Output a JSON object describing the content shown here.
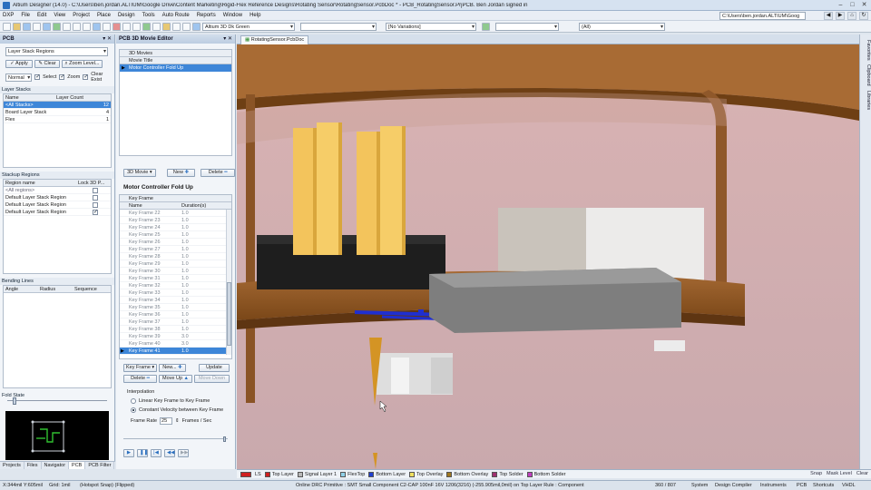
{
  "app": {
    "title": "Altium Designer (14.0) - C:\\Users\\ben.jordan.ALTIUM\\Google Drive\\Content Marketing\\Rigid-Flex Reference Designs\\Rotating Sensor\\RotatingSensor.PcbDoc * - PCB_RotatingSensor.PrjPCB. Ben Jordan signed in",
    "min_glyph": "–",
    "max_glyph": "□",
    "close_glyph": "✕"
  },
  "menu": {
    "items": [
      "DXP",
      "File",
      "Edit",
      "View",
      "Project",
      "Place",
      "Design",
      "Tools",
      "Auto Route",
      "Reports",
      "Window",
      "Help"
    ],
    "path": "C:\\Users\\ben.jordan.ALTIUM\\Goog"
  },
  "toolbar": {
    "view_config": "Altium 3D Dk Green",
    "variations": "[No Variations]",
    "filter": "(All)"
  },
  "pcb_panel": {
    "title": "PCB",
    "mode": "Layer Stack Regions",
    "apply": "Apply",
    "clear": "Clear",
    "zoom_level": "Zoom Level...",
    "normal": "Normal",
    "select": "Select",
    "zoom": "Zoom",
    "clear_existing": "Clear Exist",
    "layer_stacks": {
      "heading": "Layer Stacks",
      "col_name": "Name",
      "col_count": "Layer Count",
      "rows": [
        {
          "name": "<All Stacks>",
          "count": "12"
        },
        {
          "name": "Board Layer Stack",
          "count": "4"
        },
        {
          "name": "Flex",
          "count": "1"
        }
      ]
    },
    "stackup_regions": {
      "heading": "Stackup Regions",
      "col_name": "Region name",
      "col_lock": "Lock 3D P...",
      "rows": [
        {
          "name": "<All regions>",
          "locked": false
        },
        {
          "name": "Default Layer Stack Region",
          "locked": false
        },
        {
          "name": "Default Layer Stack Region",
          "locked": false
        },
        {
          "name": "Default Layer Stack Region",
          "locked": true
        }
      ]
    },
    "bending_lines": {
      "heading": "Bending Lines",
      "col_angle": "Angle",
      "col_radius": "Radius",
      "col_sequence": "Sequence"
    },
    "fold_state": "Fold State",
    "tabs": [
      "Projects",
      "Files",
      "Navigator",
      "PCB",
      "PCB Filter"
    ]
  },
  "movie_panel": {
    "title": "PCB 3D Movie Editor",
    "movies_heading": "3D Movies",
    "movie_title_col": "Movie Title",
    "movie_selected": "Motor Controller Fold Up",
    "btn_3d_movie": "3D Movie",
    "btn_new": "New",
    "btn_delete": "Delete",
    "movie_name": "Motor Controller Fold Up",
    "keyframe_heading": "Key Frame",
    "col_name": "Name",
    "col_duration": "Duration(s)",
    "keyframes": [
      {
        "name": "Key Frame 22",
        "duration": "1.0"
      },
      {
        "name": "Key Frame 23",
        "duration": "1.0"
      },
      {
        "name": "Key Frame 24",
        "duration": "1.0"
      },
      {
        "name": "Key Frame 25",
        "duration": "1.0"
      },
      {
        "name": "Key Frame 26",
        "duration": "1.0"
      },
      {
        "name": "Key Frame 27",
        "duration": "1.0"
      },
      {
        "name": "Key Frame 28",
        "duration": "1.0"
      },
      {
        "name": "Key Frame 29",
        "duration": "1.0"
      },
      {
        "name": "Key Frame 30",
        "duration": "1.0"
      },
      {
        "name": "Key Frame 31",
        "duration": "1.0"
      },
      {
        "name": "Key Frame 32",
        "duration": "1.0"
      },
      {
        "name": "Key Frame 33",
        "duration": "1.0"
      },
      {
        "name": "Key Frame 34",
        "duration": "1.0"
      },
      {
        "name": "Key Frame 35",
        "duration": "1.0"
      },
      {
        "name": "Key Frame 36",
        "duration": "1.0"
      },
      {
        "name": "Key Frame 37",
        "duration": "1.0"
      },
      {
        "name": "Key Frame 38",
        "duration": "1.0"
      },
      {
        "name": "Key Frame 39",
        "duration": "3.0"
      },
      {
        "name": "Key Frame 40",
        "duration": "3.0"
      },
      {
        "name": "Key Frame 41",
        "duration": "1.0"
      }
    ],
    "btn_keyframe": "Key Frame",
    "btn_kf_new": "New...",
    "btn_update": "Update",
    "btn_kf_delete": "Delete",
    "btn_move_up": "Move Up",
    "btn_move_down": "Move Down",
    "interpolation_heading": "Interpolation",
    "opt_linear": "Linear Key Frame to Key Frame",
    "opt_constant": "Constant Velocity between Key Frame",
    "frame_rate_label": "Frame Rate",
    "frame_rate_value": "25",
    "frame_rate_unit": "Frames / Sec"
  },
  "document": {
    "tab": "RotatingSensor.PcbDoc"
  },
  "right_tabs": [
    "Favorites",
    "Clipboard",
    "Libraries"
  ],
  "layers": [
    {
      "name": "Top Layer",
      "color": "#d02020"
    },
    {
      "name": "Signal Layer 1",
      "color": "#b8b8b8"
    },
    {
      "name": "FlexTop",
      "color": "#8fd0e8"
    },
    {
      "name": "Bottom Layer",
      "color": "#2040d0"
    },
    {
      "name": "Top Overlay",
      "color": "#f0e060"
    },
    {
      "name": "Bottom Overlay",
      "color": "#a07820"
    },
    {
      "name": "Top Solder",
      "color": "#a03070"
    },
    {
      "name": "Bottom Solder",
      "color": "#c040c0"
    }
  ],
  "layer_right": [
    "Snap",
    "Mask Level",
    "Clear"
  ],
  "status": {
    "coords": "X:344mil Y:605mil",
    "grid": "Grid: 1mil",
    "snap": "(Hotspot Snap) (Flipped)",
    "drc": "Online DRC Primitive : SMT Small Component C2-CAP 100nF 16V 1206(3216) (-255.905mil,0mil) on Top Layer Rule : Component",
    "counter": "360 / 807",
    "buttons": [
      "System",
      "Design Compiler",
      "Instruments",
      "PCB",
      "Shortcuts",
      "VHDL"
    ]
  }
}
